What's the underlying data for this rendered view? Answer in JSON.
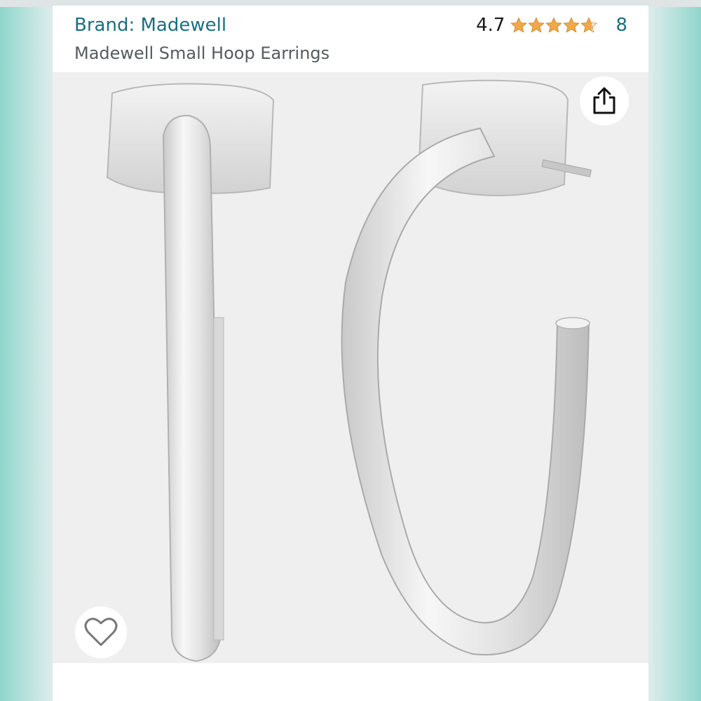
{
  "header": {
    "brand": "Brand: Madewell",
    "title": "Madewell Small Hoop Earrings"
  },
  "rating": {
    "value": "4.7",
    "stars": 4.7,
    "count": "8"
  },
  "image": {
    "description_icon": "product-image",
    "share_icon": "share-icon",
    "wishlist_icon": "heart-icon"
  },
  "colors": {
    "brand_link": "#1a6f84",
    "star": "#f3a847",
    "text": "#555b5f",
    "image_bg": "#efefef"
  }
}
